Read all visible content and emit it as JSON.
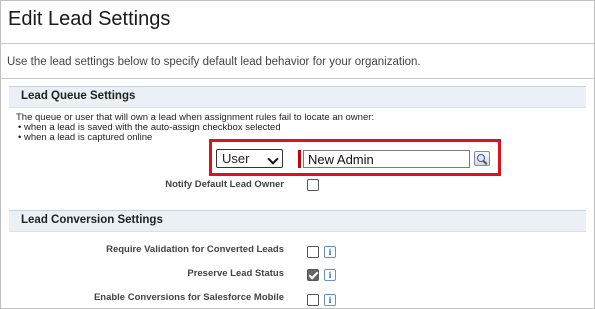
{
  "page": {
    "title": "Edit Lead Settings",
    "description": "Use the lead settings below to specify default lead behavior for your organization."
  },
  "queue_section": {
    "heading": "Lead Queue Settings",
    "intro": "The queue or user that will own a lead when assignment rules fail to locate an owner:",
    "bullets": [
      "• when a lead is saved with the auto-assign checkbox selected",
      "• when a lead is captured online"
    ],
    "owner_type": {
      "selected": "User"
    },
    "owner_value": "New Admin",
    "notify_label": "Notify Default Lead Owner",
    "notify_checked": false
  },
  "conversion_section": {
    "heading": "Lead Conversion Settings",
    "rows": [
      {
        "label": "Require Validation for Converted Leads",
        "checked": false,
        "info": "i"
      },
      {
        "label": "Preserve Lead Status",
        "checked": true,
        "info": "i"
      },
      {
        "label": "Enable Conversions for Salesforce Mobile",
        "checked": false,
        "info": "i"
      }
    ]
  },
  "colors": {
    "highlight": "#e0101c",
    "section_bg": "#eaf0f6",
    "required_bar": "#cc0000"
  }
}
